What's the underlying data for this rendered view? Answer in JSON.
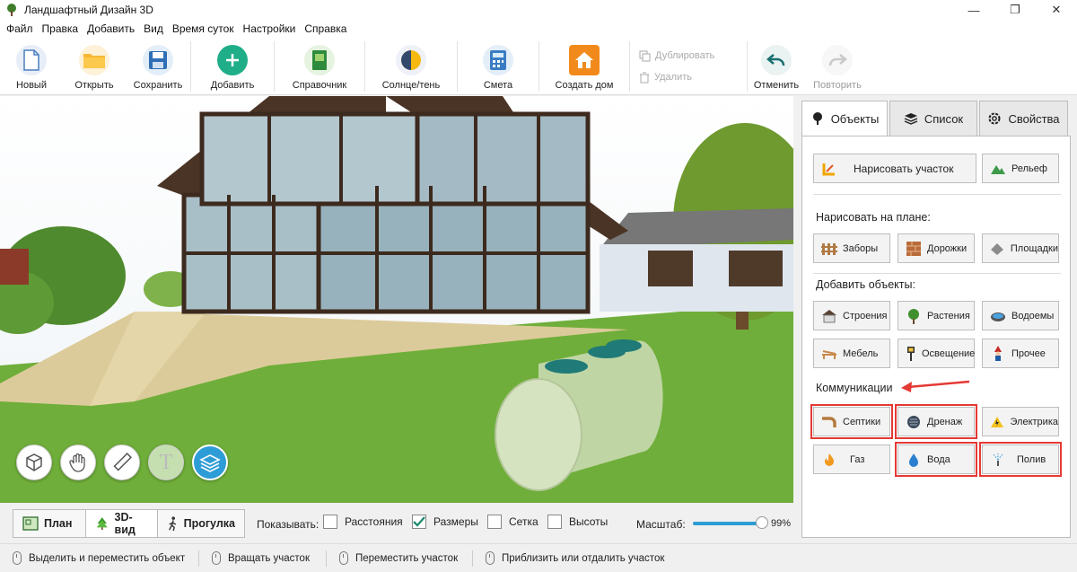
{
  "window": {
    "title": "Ландшафтный Дизайн 3D",
    "minimize": "—",
    "maximize": "❐",
    "close": "✕"
  },
  "menu": [
    "Файл",
    "Правка",
    "Добавить",
    "Вид",
    "Время суток",
    "Настройки",
    "Справка"
  ],
  "toolbar": {
    "new": "Новый",
    "open": "Открыть",
    "save": "Сохранить",
    "add": "Добавить",
    "reference": "Справочник",
    "sun_shadow": "Солнце/тень",
    "estimate": "Смета",
    "create_house": "Создать дом",
    "duplicate": "Дублировать",
    "delete": "Удалить",
    "undo": "Отменить",
    "redo": "Повторить"
  },
  "panel": {
    "tabs": {
      "objects": "Объекты",
      "list": "Список",
      "properties": "Свойства"
    },
    "draw_plot": "Нарисовать участок",
    "relief": "Рельеф",
    "draw_on_plan_title": "Нарисовать на плане:",
    "fences": "Заборы",
    "paths": "Дорожки",
    "platforms": "Площадки",
    "add_objects_title": "Добавить объекты:",
    "buildings": "Строения",
    "plants": "Растения",
    "ponds": "Водоемы",
    "furniture": "Мебель",
    "lighting": "Освещение",
    "other": "Прочее",
    "communications_title": "Коммуникации",
    "septic": "Септики",
    "drainage": "Дренаж",
    "electric": "Электрика",
    "gas": "Газ",
    "water": "Вода",
    "irrigation": "Полив"
  },
  "viewtabs": {
    "plan": "План",
    "view3d": "3D-вид",
    "walk": "Прогулка"
  },
  "show": {
    "label": "Показывать:",
    "distances": "Расстояния",
    "sizes": "Размеры",
    "grid": "Сетка",
    "heights": "Высоты"
  },
  "checks": {
    "distances": false,
    "sizes": true,
    "grid": false,
    "heights": false
  },
  "scale": {
    "label": "Масштаб:",
    "value": "99%",
    "fraction": 0.99
  },
  "status": {
    "select_move": "Выделить и переместить объект",
    "rotate": "Вращать участок",
    "move": "Переместить участок",
    "zoom": "Приблизить или отдалить участок"
  },
  "colors": {
    "accent": "#2e9cd6",
    "highlight": "#e53935",
    "grass": "#6fae3a"
  },
  "icons": {
    "viewport_tools": [
      "objects-icon",
      "hand-icon",
      "ruler-icon",
      "text-icon",
      "layers-icon"
    ]
  }
}
